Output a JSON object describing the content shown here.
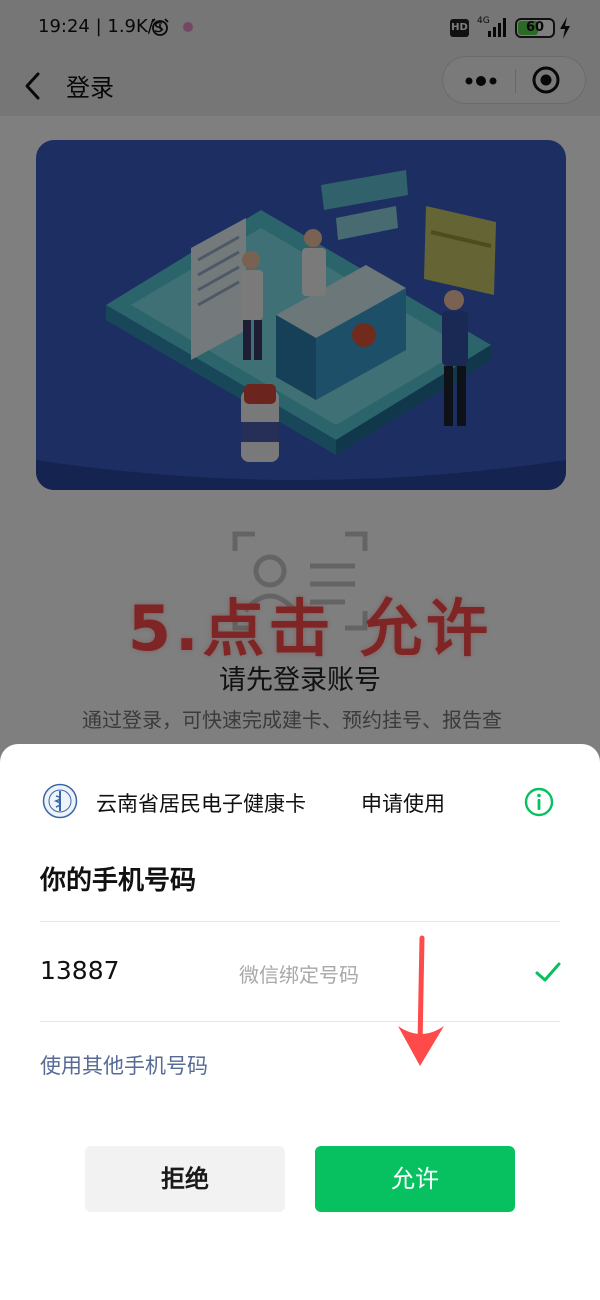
{
  "status_bar": {
    "time": "19:24 | 1.9K/s",
    "hd_label": "HD",
    "network_label": "4G",
    "battery_level": "60",
    "battery_percent": 60,
    "icons": [
      "alarm-icon",
      "notification-dot-icon",
      "signal-icon",
      "battery-icon",
      "charging-bolt-icon"
    ]
  },
  "nav": {
    "back_icon": "chevron-left-icon",
    "title": "登录",
    "menu_icons": [
      "more-dots-icon",
      "close-target-icon"
    ]
  },
  "page": {
    "annotation": "5.点击  允许",
    "login_title": "请先登录账号",
    "login_desc": "通过登录，可快速完成建卡、预约挂号、报告查询、健康档案等相关就医业务"
  },
  "sheet": {
    "app_name": "云南省居民电子健康卡",
    "request_label": "申请使用",
    "info_icon": "info-icon",
    "phone_heading": "你的手机号码",
    "phone_number": "13887",
    "phone_hint": "微信绑定号码",
    "selected_icon": "check-icon",
    "other_phone_link": "使用其他手机号码",
    "reject_label": "拒绝",
    "allow_label": "允许"
  },
  "colors": {
    "wechat_green": "#07c160",
    "link_blue": "#576b95",
    "annotation_red": "#ff4a4a",
    "banner_blue": "#2f4fa8"
  }
}
